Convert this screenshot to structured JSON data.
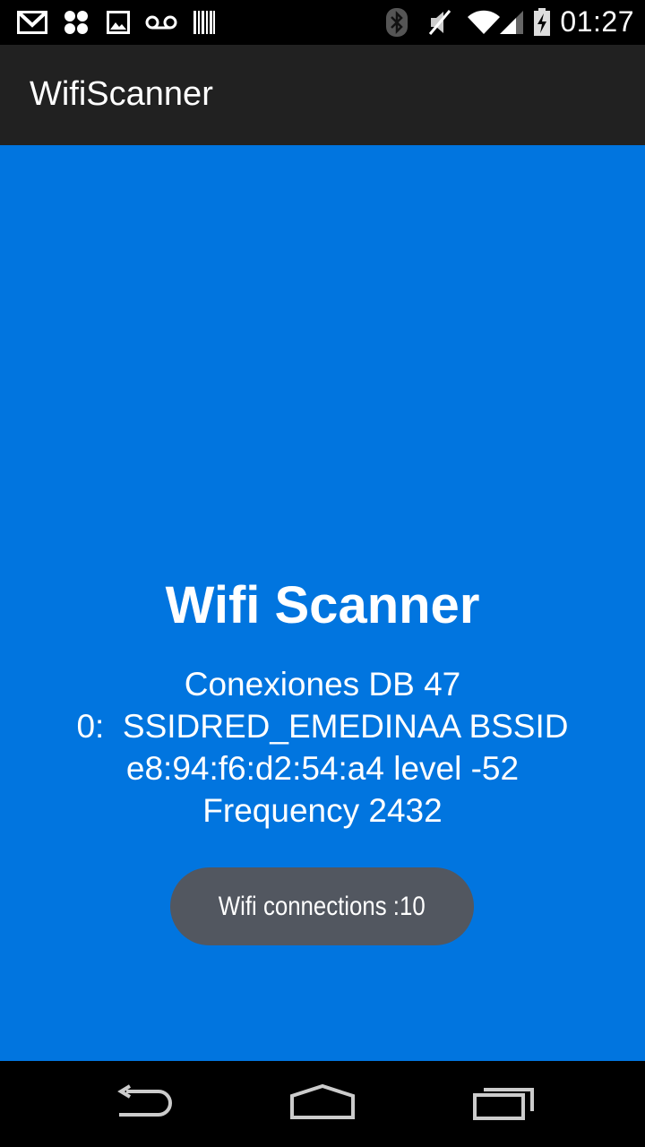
{
  "status_bar": {
    "time": "01:27",
    "left_icons": [
      "gmail-icon",
      "pinwheel-icon",
      "image-icon",
      "voicemail-icon",
      "barcode-icon"
    ],
    "right_icons": [
      "bluetooth-icon",
      "mute-icon",
      "wifi-icon",
      "signal-icon",
      "battery-icon"
    ]
  },
  "app_bar": {
    "title": "WifiScanner"
  },
  "main": {
    "title": "Wifi Scanner",
    "info_lines": [
      "Conexiones DB 47",
      "0:  SSIDRED_EMEDINAA BSSID",
      "e8:94:f6:d2:54:a4 level -52",
      "Frequency 2432"
    ],
    "toast": "Wifi connections :10"
  },
  "nav_bar": {
    "icons": [
      "back-icon",
      "home-icon",
      "recents-icon"
    ]
  },
  "colors": {
    "background": "#0175df",
    "app_bar": "#212121",
    "toast": "#525760"
  }
}
